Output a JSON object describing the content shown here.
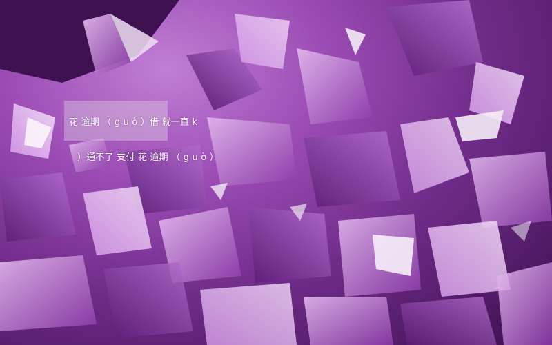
{
  "caption": {
    "line1": "花    逾期      （ g u ò ）借    就一直          k",
    "line2": "）通不了         支付  花    逾期    （ g u ò ）"
  },
  "colors": {
    "highlight": "#dcc8e1",
    "text": "#ffffff",
    "crystal_light": "#d9a6e8",
    "crystal_dark": "#4a1560"
  }
}
